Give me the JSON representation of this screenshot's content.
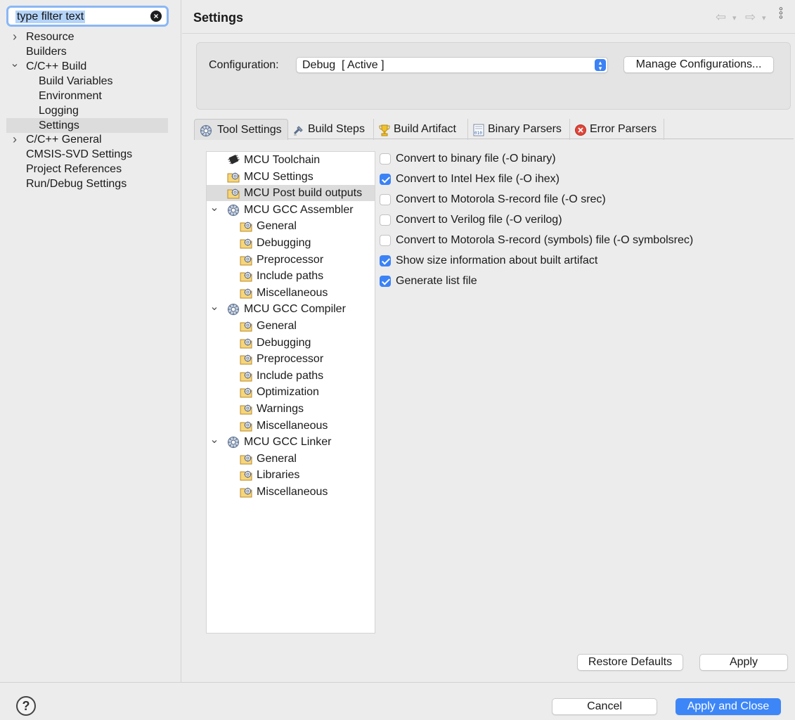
{
  "filter": {
    "placeholder": "type filter text"
  },
  "nav": [
    {
      "label": "Resource",
      "chevron": "right"
    },
    {
      "label": "Builders"
    },
    {
      "label": "C/C++ Build",
      "chevron": "down"
    },
    {
      "label": "Build Variables"
    },
    {
      "label": "Environment"
    },
    {
      "label": "Logging"
    },
    {
      "label": "Settings",
      "selected": true
    },
    {
      "label": "C/C++ General",
      "chevron": "right"
    },
    {
      "label": "CMSIS-SVD Settings"
    },
    {
      "label": "Project References"
    },
    {
      "label": "Run/Debug Settings"
    }
  ],
  "header": {
    "title": "Settings"
  },
  "configuration": {
    "label": "Configuration:",
    "value": "Debug  [ Active ]",
    "manage_button": "Manage Configurations..."
  },
  "tabs": [
    {
      "label": "Tool Settings",
      "icon": "tool-settings-icon",
      "active": true
    },
    {
      "label": "Build Steps",
      "icon": "build-steps-icon"
    },
    {
      "label": "Build Artifact",
      "icon": "trophy-icon"
    },
    {
      "label": "Binary Parsers",
      "icon": "binary-parser-icon"
    },
    {
      "label": "Error Parsers",
      "icon": "error-icon"
    }
  ],
  "tree": [
    {
      "label": "MCU Toolchain",
      "icon": "chip-icon"
    },
    {
      "label": "MCU Settings",
      "icon": "folder-gear-icon"
    },
    {
      "label": "MCU Post build outputs",
      "icon": "folder-gear-icon",
      "selected": true
    },
    {
      "label": "MCU GCC Assembler",
      "icon": "tool-gear-icon",
      "expanded": true
    },
    {
      "label": "General",
      "icon": "folder-gear-icon",
      "child": true
    },
    {
      "label": "Debugging",
      "icon": "folder-gear-icon",
      "child": true
    },
    {
      "label": "Preprocessor",
      "icon": "folder-gear-icon",
      "child": true
    },
    {
      "label": "Include paths",
      "icon": "folder-gear-icon",
      "child": true
    },
    {
      "label": "Miscellaneous",
      "icon": "folder-gear-icon",
      "child": true
    },
    {
      "label": "MCU GCC Compiler",
      "icon": "tool-gear-icon",
      "expanded": true
    },
    {
      "label": "General",
      "icon": "folder-gear-icon",
      "child": true
    },
    {
      "label": "Debugging",
      "icon": "folder-gear-icon",
      "child": true
    },
    {
      "label": "Preprocessor",
      "icon": "folder-gear-icon",
      "child": true
    },
    {
      "label": "Include paths",
      "icon": "folder-gear-icon",
      "child": true
    },
    {
      "label": "Optimization",
      "icon": "folder-gear-icon",
      "child": true
    },
    {
      "label": "Warnings",
      "icon": "folder-gear-icon",
      "child": true
    },
    {
      "label": "Miscellaneous",
      "icon": "folder-gear-icon",
      "child": true
    },
    {
      "label": "MCU GCC Linker",
      "icon": "tool-gear-icon",
      "expanded": true
    },
    {
      "label": "General",
      "icon": "folder-gear-icon",
      "child": true
    },
    {
      "label": "Libraries",
      "icon": "folder-gear-icon",
      "child": true
    },
    {
      "label": "Miscellaneous",
      "icon": "folder-gear-icon",
      "child": true
    }
  ],
  "options": [
    {
      "label": "Convert to binary file (-O binary)",
      "checked": false
    },
    {
      "label": "Convert to Intel Hex file (-O ihex)",
      "checked": true
    },
    {
      "label": "Convert to Motorola S-record file (-O srec)",
      "checked": false
    },
    {
      "label": "Convert to Verilog file (-O verilog)",
      "checked": false
    },
    {
      "label": "Convert to Motorola S-record (symbols) file (-O symbolsrec)",
      "checked": false
    },
    {
      "label": "Show size information about built artifact",
      "checked": true
    },
    {
      "label": "Generate list file",
      "checked": true
    }
  ],
  "buttons": {
    "restore_defaults": "Restore Defaults",
    "apply": "Apply",
    "cancel": "Cancel",
    "apply_and_close": "Apply and Close"
  },
  "help": "?",
  "colors": {
    "accent": "#3d86f7",
    "selection": "#dcdcdc",
    "filter_focus": "#8ab7f5"
  }
}
